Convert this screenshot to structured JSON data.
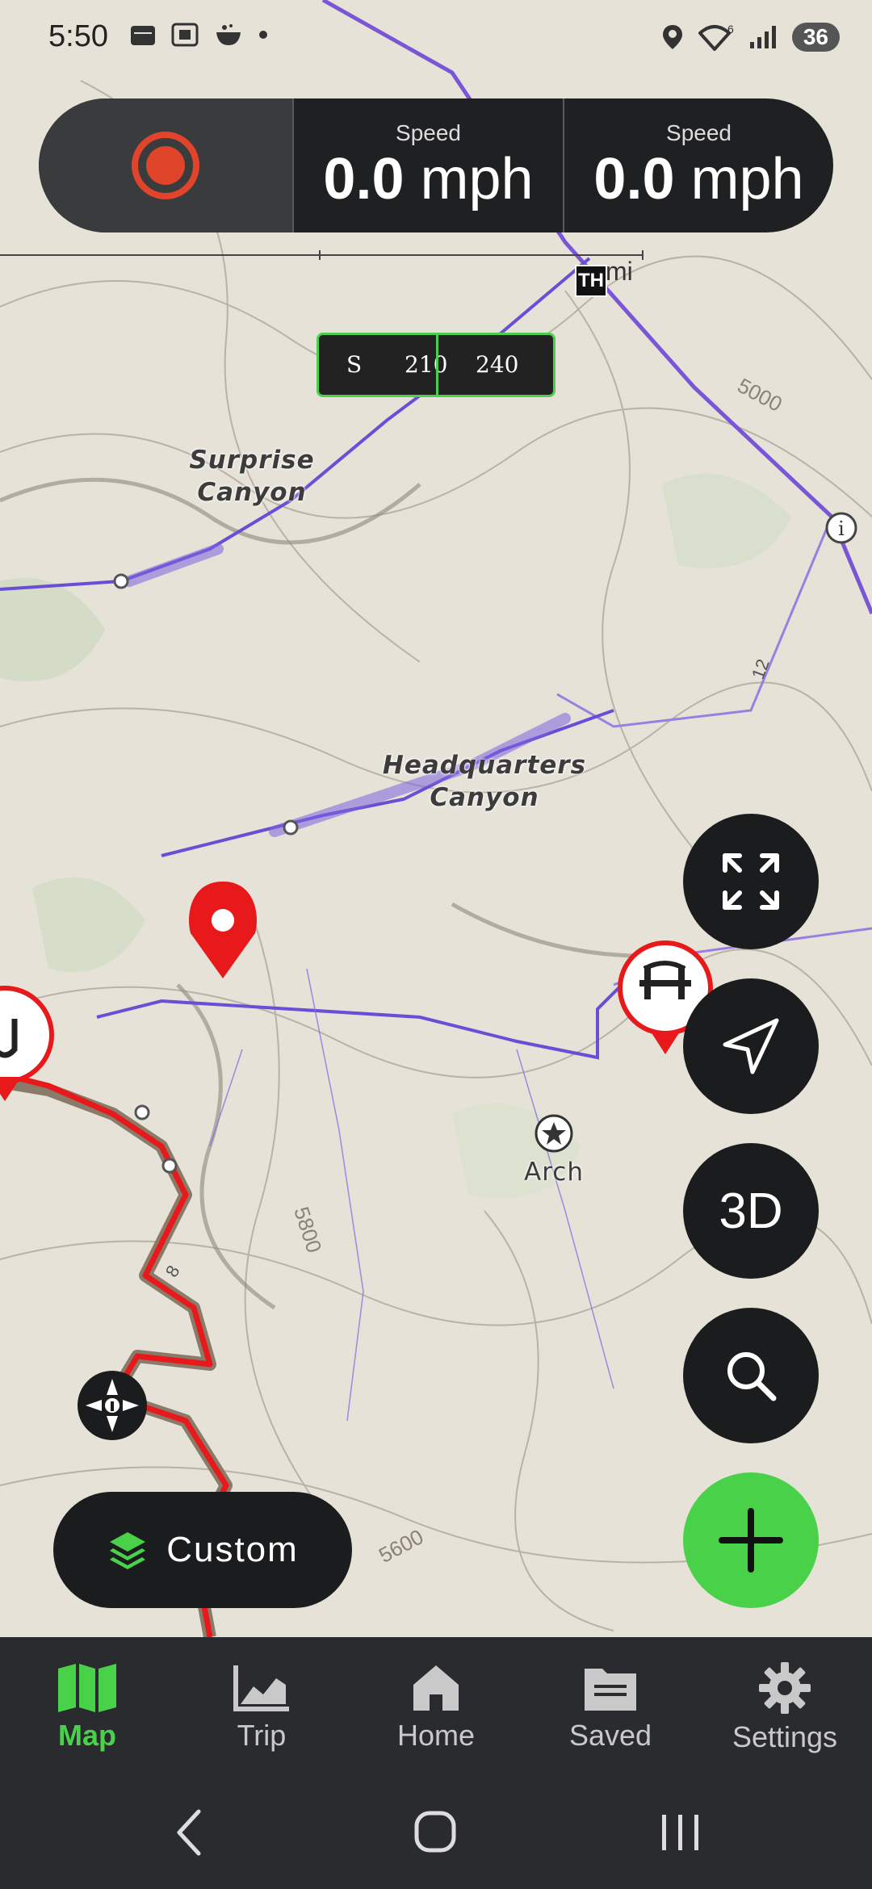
{
  "status_bar": {
    "time": "5:50",
    "battery": "36",
    "signal_sup": "6"
  },
  "speed_panel": {
    "record_icon": "record-icon",
    "cells": [
      {
        "label": "Speed",
        "value": "0.0",
        "unit": "mph"
      },
      {
        "label": "Speed",
        "value": "0.0",
        "unit": "mph"
      }
    ]
  },
  "compass": {
    "marks": [
      "S",
      "210",
      "240"
    ]
  },
  "map": {
    "scale_label": "mi",
    "trailhead_badge": "TH",
    "labels": {
      "surprise": [
        "Surprise",
        "Canyon"
      ],
      "headquarters": [
        "Headquarters",
        "Canyon"
      ],
      "arch": "Arch"
    },
    "contours": [
      "5000",
      "5800",
      "5600"
    ],
    "route_numbers": [
      "12",
      "8"
    ]
  },
  "fabs": {
    "fullscreen": "expand-icon",
    "navigate": "navigate-icon",
    "three_d": "3D",
    "search": "search-icon",
    "add": "plus-icon"
  },
  "layers_button": {
    "label": "Custom",
    "icon": "layers-icon"
  },
  "bottom_nav": {
    "items": [
      {
        "label": "Map",
        "icon": "map-icon",
        "active": true
      },
      {
        "label": "Trip",
        "icon": "chart-icon",
        "active": false
      },
      {
        "label": "Home",
        "icon": "home-icon",
        "active": false
      },
      {
        "label": "Saved",
        "icon": "folder-icon",
        "active": false
      },
      {
        "label": "Settings",
        "icon": "gear-icon",
        "active": false
      }
    ]
  },
  "colors": {
    "accent": "#49d249",
    "record": "#e0442a",
    "trail": "#6a4ed6",
    "route": "#e8191b"
  }
}
